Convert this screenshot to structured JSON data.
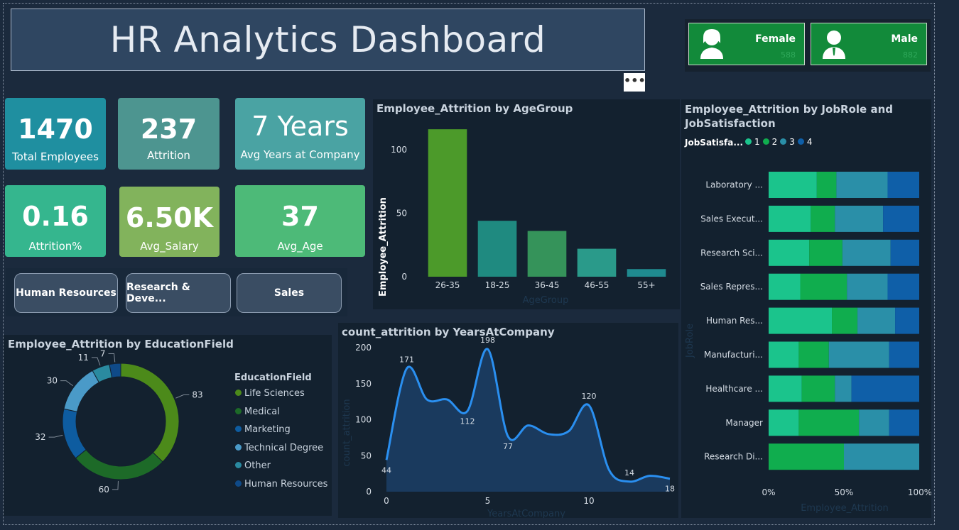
{
  "header": {
    "title": "HR Analytics Dashboard",
    "more_label": "•••"
  },
  "gender": [
    {
      "label": "Female",
      "value": "588",
      "icon": "female-user-icon"
    },
    {
      "label": "Male",
      "value": "882",
      "icon": "male-user-icon"
    }
  ],
  "kpis": [
    {
      "value": "1470",
      "label": "Total Employees",
      "color": "#1f8fa0"
    },
    {
      "value": "237",
      "label": "Attrition",
      "color": "#4d9590"
    },
    {
      "value": "7 Years",
      "label": "Avg Years at Company",
      "color": "#4aa3a3"
    },
    {
      "value": "0.16",
      "label": "Attrition%",
      "color": "#35b68e"
    },
    {
      "value": "6.50K",
      "label": "Avg_Salary",
      "color": "#82b35c"
    },
    {
      "value": "37",
      "label": "Avg_Age",
      "color": "#4dba78"
    }
  ],
  "departments": [
    "Human Resources",
    "Research & Deve...",
    "Sales"
  ],
  "colors": {
    "green_dark": "#4c9a2a",
    "teal": "#208a8a",
    "green_mid": "#35935a",
    "teal_light": "#2a9a8a",
    "line_blue": "#2a8ff0",
    "area_fill": "#1a3a5e",
    "js1": "#1bc48c",
    "js2": "#10ad4e",
    "js3": "#2a8fa8",
    "js4": "#0f5fa8"
  },
  "chart_data": [
    {
      "id": "age_group",
      "type": "bar",
      "title": "Employee_Attrition by AgeGroup",
      "xlabel": "AgeGroup",
      "ylabel": "Employee_Attrition",
      "categories": [
        "26-35",
        "18-25",
        "36-45",
        "46-55",
        "55+"
      ],
      "values": [
        116,
        44,
        36,
        22,
        6
      ],
      "ylim": [
        0,
        120
      ],
      "yticks": [
        0,
        50,
        100
      ],
      "bar_colors": [
        "#4c9a2a",
        "#1f8a80",
        "#35935a",
        "#2a9a8a",
        "#1f8a8f"
      ]
    },
    {
      "id": "education_field",
      "type": "pie",
      "title": "Employee_Attrition by EducationField",
      "legend_title": "EducationField",
      "categories": [
        "Life Sciences",
        "Medical",
        "Marketing",
        "Technical Degree",
        "Other",
        "Human Resources"
      ],
      "values": [
        83,
        60,
        32,
        30,
        11,
        7
      ],
      "colors": [
        "#4c8a1a",
        "#1d6a28",
        "#0e5ca0",
        "#4a9ac8",
        "#2a8aa0",
        "#0f4a88"
      ]
    },
    {
      "id": "years_at_company",
      "type": "area",
      "title": "count_attrition by YearsAtCompany",
      "xlabel": "YearsAtCompany",
      "ylabel": "count_attrition",
      "x": [
        0,
        1,
        2,
        3,
        4,
        5,
        6,
        7,
        8,
        9,
        10,
        11,
        12,
        13,
        14
      ],
      "values": [
        44,
        171,
        128,
        128,
        112,
        198,
        77,
        92,
        80,
        84,
        120,
        30,
        14,
        22,
        18
      ],
      "labels_shown": {
        "0": "44",
        "1": "171",
        "4": "112",
        "5": "198",
        "6": "77",
        "10": "120",
        "12": "14",
        "14": "18"
      },
      "ylim": [
        0,
        200
      ],
      "yticks": [
        0,
        50,
        100,
        150,
        200
      ],
      "xticks": [
        0,
        5,
        10
      ]
    },
    {
      "id": "job_role_satisfaction",
      "type": "bar",
      "orientation": "horizontal-stacked-100",
      "title": "Employee_Attrition by JobRole and JobSatisfaction",
      "legend_title": "JobSatisfa...",
      "xlabel": "Employee_Attrition",
      "ylabel": "JobRole",
      "categories": [
        "Laboratory ...",
        "Sales Execut...",
        "Research Sci...",
        "Sales Repres...",
        "Human Res...",
        "Manufacturi...",
        "Healthcare ...",
        "Manager",
        "Research Di..."
      ],
      "xticks": [
        "0%",
        "50%",
        "100%"
      ],
      "series": [
        {
          "name": "1",
          "values": [
            0.32,
            0.28,
            0.27,
            0.21,
            0.42,
            0.2,
            0.22,
            0.2,
            0.0
          ]
        },
        {
          "name": "2",
          "values": [
            0.13,
            0.16,
            0.22,
            0.31,
            0.17,
            0.2,
            0.22,
            0.4,
            0.5
          ]
        },
        {
          "name": "3",
          "values": [
            0.34,
            0.32,
            0.32,
            0.27,
            0.25,
            0.4,
            0.11,
            0.2,
            0.5
          ]
        },
        {
          "name": "4",
          "values": [
            0.21,
            0.24,
            0.19,
            0.21,
            0.16,
            0.2,
            0.45,
            0.2,
            0.0
          ]
        }
      ]
    }
  ]
}
